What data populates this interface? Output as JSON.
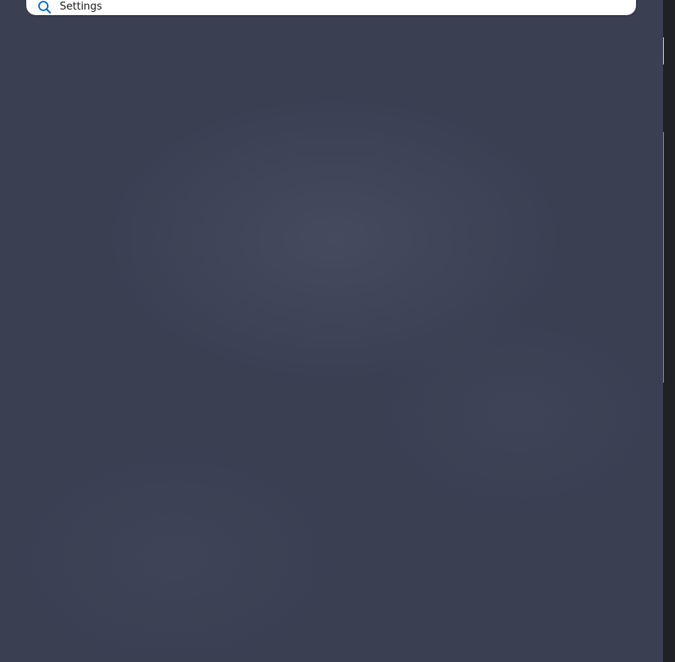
{
  "start_menu": {
    "search": {
      "value": "Settings",
      "icon": "search-icon"
    }
  },
  "colors": {
    "panel_background": "#3a4052",
    "search_background": "#ffffff",
    "search_icon_accent": "#0067c0",
    "side_strip": "#202124"
  }
}
